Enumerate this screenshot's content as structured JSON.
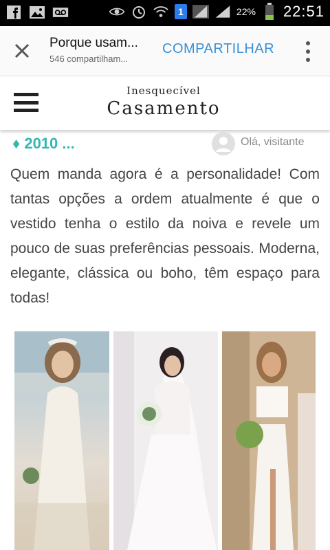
{
  "status_bar": {
    "notification_badge": "1",
    "battery_percent": "22%",
    "time": "22:51"
  },
  "app_bar": {
    "title": "Porque usam...",
    "subtitle": "546 compartilham...",
    "share_label": "COMPARTILHAR",
    "share_color": "#3a8fd6"
  },
  "site_header": {
    "logo_top": "Inesquecível",
    "logo_main": "Casamento"
  },
  "meta": {
    "era_label": "♦ 2010 ...",
    "greeting": "Olá, visitante",
    "accent_color": "#35b6b0"
  },
  "article": {
    "text": "Quem manda agora é a personalidade! Com tantas opções a ordem atualmente é que o vestido tenha o estilo da noiva e revele um pouco de suas preferências pessoais. Moderna, elegante, clássica ou boho, têm espaço para todas!"
  },
  "photos": [
    {
      "icon": "bride-beach-boho-photo"
    },
    {
      "icon": "bride-lace-gown-photo"
    },
    {
      "icon": "bride-two-piece-photo"
    }
  ]
}
